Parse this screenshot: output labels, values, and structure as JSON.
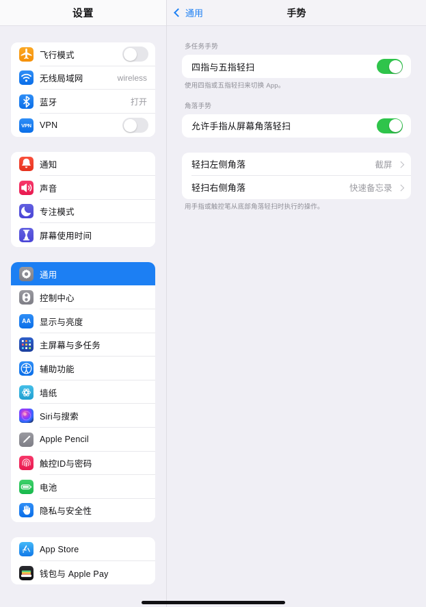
{
  "sidebar": {
    "title": "设置",
    "groups": [
      {
        "items": [
          {
            "label": "飞行模式",
            "icon": "airplane-icon",
            "control": "toggle",
            "on": false
          },
          {
            "label": "无线局域网",
            "icon": "wifi-icon",
            "control": "value",
            "value": "wireless"
          },
          {
            "label": "蓝牙",
            "icon": "bluetooth-icon",
            "control": "value",
            "value": "打开"
          },
          {
            "label": "VPN",
            "icon": "vpn-icon",
            "control": "toggle",
            "on": false
          }
        ]
      },
      {
        "items": [
          {
            "label": "通知",
            "icon": "notifications-icon",
            "control": "none"
          },
          {
            "label": "声音",
            "icon": "sound-icon",
            "control": "none"
          },
          {
            "label": "专注模式",
            "icon": "focus-moon-icon",
            "control": "none"
          },
          {
            "label": "屏幕使用时间",
            "icon": "screen-time-icon",
            "control": "none"
          }
        ]
      },
      {
        "items": [
          {
            "label": "通用",
            "icon": "gear-icon",
            "control": "none",
            "selected": true
          },
          {
            "label": "控制中心",
            "icon": "control-center-icon",
            "control": "none"
          },
          {
            "label": "显示与亮度",
            "icon": "display-brightness-icon",
            "control": "none"
          },
          {
            "label": "主屏幕与多任务",
            "icon": "home-screen-icon",
            "control": "none"
          },
          {
            "label": "辅助功能",
            "icon": "accessibility-icon",
            "control": "none"
          },
          {
            "label": "墙纸",
            "icon": "wallpaper-icon",
            "control": "none"
          },
          {
            "label": "Siri与搜索",
            "icon": "siri-icon",
            "control": "none"
          },
          {
            "label": "Apple Pencil",
            "icon": "apple-pencil-icon",
            "control": "none"
          },
          {
            "label": "触控ID与密码",
            "icon": "touch-id-icon",
            "control": "none"
          },
          {
            "label": "电池",
            "icon": "battery-icon",
            "control": "none"
          },
          {
            "label": "隐私与安全性",
            "icon": "privacy-hand-icon",
            "control": "none"
          }
        ]
      },
      {
        "items": [
          {
            "label": "App Store",
            "icon": "app-store-icon",
            "control": "none"
          },
          {
            "label": "钱包与 Apple Pay",
            "icon": "wallet-icon",
            "control": "none"
          }
        ]
      }
    ]
  },
  "detail": {
    "back_label": "通用",
    "title": "手势",
    "sections": [
      {
        "header": "多任务手势",
        "rows": [
          {
            "label": "四指与五指轻扫",
            "control": "toggle",
            "on": true
          }
        ],
        "footer": "使用四指或五指轻扫来切换 App。"
      },
      {
        "header": "角落手势",
        "rows": [
          {
            "label": "允许手指从屏幕角落轻扫",
            "control": "toggle",
            "on": true
          }
        ],
        "footer": ""
      },
      {
        "header": "",
        "rows": [
          {
            "label": "轻扫左侧角落",
            "control": "disclosure",
            "value": "截屏"
          },
          {
            "label": "轻扫右侧角落",
            "control": "disclosure",
            "value": "快速备忘录"
          }
        ],
        "footer": "用手指或触控笔从底部角落轻扫时执行的操作。"
      }
    ]
  },
  "colors": {
    "accent_blue": "#1c7ff3",
    "toggle_on_green": "#2fc44b",
    "toggle_off_gray": "#e6e6ea",
    "background": "#f0eff5"
  }
}
